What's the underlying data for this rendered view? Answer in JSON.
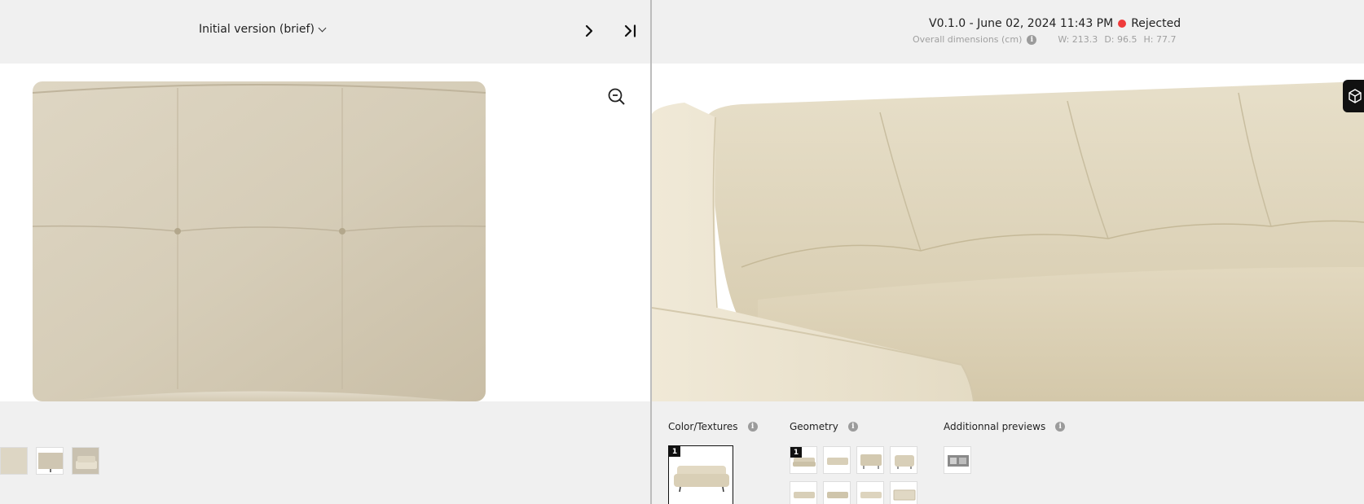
{
  "left": {
    "version_label": "Initial version (brief)"
  },
  "right": {
    "version_text": "V0.1.0 - June 02, 2024 11:43 PM",
    "status_label": "Rejected",
    "status_color": "#ef3b3b",
    "dims_label": "Overall dimensions (cm)",
    "dims_w": "W: 213.3",
    "dims_d": "D: 96.5",
    "dims_h": "H: 77.7"
  },
  "sections": {
    "color_textures": {
      "title": "Color/Textures",
      "badge": "1"
    },
    "geometry": {
      "title": "Geometry",
      "badge": "1"
    },
    "additional_previews": {
      "title": "Additionnal previews"
    }
  },
  "icons": {
    "zoom": "zoom-out-icon",
    "next": "chevron-right-icon",
    "last": "skip-last-icon",
    "info": "info-icon",
    "cube": "cube-icon"
  },
  "colors": {
    "fabric": "#d8cfb8",
    "background": "#f0f0f0"
  }
}
